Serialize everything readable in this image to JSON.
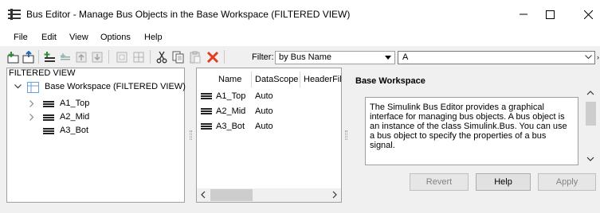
{
  "window": {
    "title": "Bus Editor - Manage Bus Objects in the Base Workspace (FILTERED VIEW)"
  },
  "menu": [
    "File",
    "Edit",
    "View",
    "Options",
    "Help"
  ],
  "toolbar": {
    "filter_label": "Filter:",
    "filter_by": "by Bus Name",
    "filter_value": "A",
    "overflow": "›"
  },
  "tree": {
    "header": "FILTERED VIEW",
    "root": "Base Workspace (FILTERED VIEW)",
    "items": [
      {
        "label": "A1_Top",
        "expandable": true
      },
      {
        "label": "A2_Mid",
        "expandable": true
      },
      {
        "label": "A3_Bot",
        "expandable": false
      }
    ]
  },
  "table": {
    "headers": [
      "Name",
      "DataScope",
      "HeaderFile"
    ],
    "rows": [
      {
        "name": "A1_Top",
        "scope": "Auto"
      },
      {
        "name": "A2_Mid",
        "scope": "Auto"
      },
      {
        "name": "A3_Bot",
        "scope": "Auto"
      }
    ]
  },
  "detail": {
    "title": "Base Workspace",
    "description": "The Simulink Bus Editor provides a graphical interface for managing bus objects. A bus object is an instance of the class Simulink.Bus. You can use a bus object to specify the properties of a bus signal."
  },
  "buttons": {
    "revert": "Revert",
    "help": "Help",
    "apply": "Apply"
  },
  "colors": {
    "delete_icon": "#e53a1f",
    "add_icon": "#2e8b3a",
    "tree_root_icon": "#6aa0d8"
  }
}
